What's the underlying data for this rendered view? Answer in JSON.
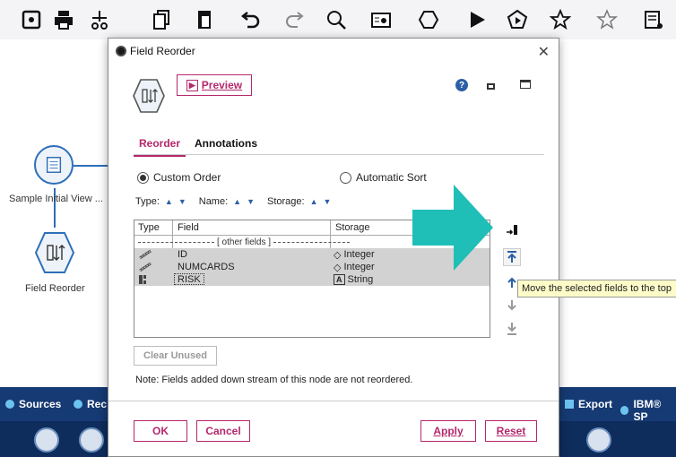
{
  "toolbar": {
    "icons": [
      "save-icon",
      "print-icon",
      "cut-icon",
      "copy-icon",
      "paste-icon",
      "undo-icon",
      "redo-icon",
      "search-icon",
      "stream-properties-icon",
      "supernode-icon",
      "run-icon",
      "run-selection-icon",
      "favorite-add-icon",
      "favorite-remove-icon",
      "annotation-icon"
    ]
  },
  "canvas": {
    "nodes": [
      {
        "label": "Sample Initial View ..."
      },
      {
        "label": "Field Reorder"
      }
    ]
  },
  "palette": {
    "tabs": [
      {
        "label": "Sources",
        "color": "#6cc3f0"
      },
      {
        "label": "Rec",
        "color": "#6cc3f0"
      },
      {
        "label": "Export",
        "color": "#6cc3f0"
      },
      {
        "label": "IBM® SP",
        "color": "#6cc3f0"
      }
    ]
  },
  "dialog": {
    "title": "Field Reorder",
    "preview_label": "Preview",
    "help_symbol": "?",
    "tabs": {
      "reorder": "Reorder",
      "annotations": "Annotations"
    },
    "options": {
      "custom_order": "Custom Order",
      "automatic_sort": "Automatic Sort",
      "selected": "custom_order"
    },
    "sort": {
      "type": "Type:",
      "name": "Name:",
      "storage": "Storage:"
    },
    "table": {
      "headers": {
        "type": "Type",
        "field": "Field",
        "storage": "Storage"
      },
      "other_fields": "[ other fields ]",
      "rows": [
        {
          "field": "ID",
          "storage": "Integer",
          "type_icon": "continuous-icon",
          "storage_icon": "integer-icon"
        },
        {
          "field": "NUMCARDS",
          "storage": "Integer",
          "type_icon": "continuous-icon",
          "storage_icon": "integer-icon"
        },
        {
          "field": "RISK",
          "storage": "String",
          "type_icon": "nominal-icon",
          "storage_icon": "string-icon",
          "storage_symbol": "A"
        }
      ]
    },
    "clear_unused": "Clear Unused",
    "note": "Note: Fields added down stream of this node are not reordered.",
    "buttons": {
      "ok": "OK",
      "cancel": "Cancel",
      "apply": "Apply",
      "reset": "Reset"
    }
  },
  "tooltip": "Move the selected fields to the top",
  "colors": {
    "accent": "#b4286c",
    "highlight_arrow": "#1fbfb8",
    "palette_bar": "#163a73",
    "link": "#2d6fb8"
  }
}
